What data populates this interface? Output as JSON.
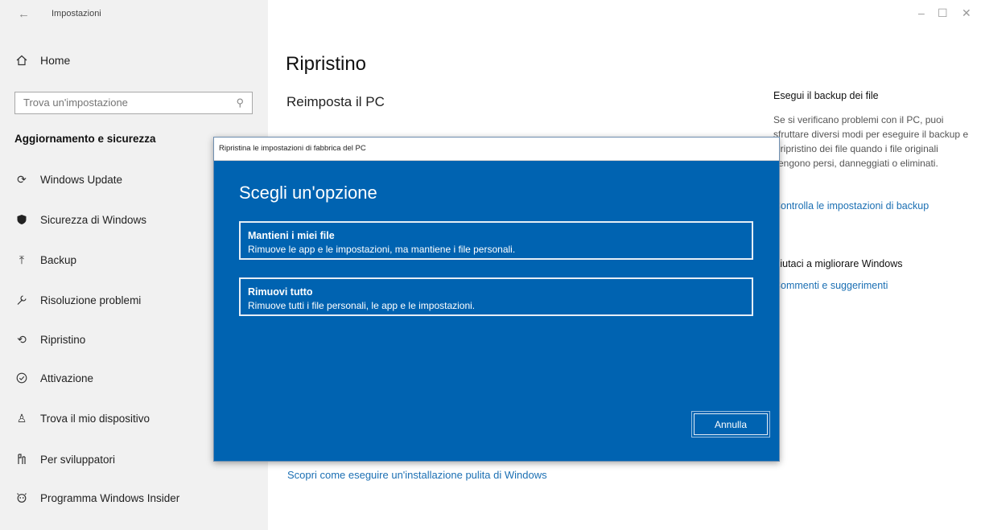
{
  "window": {
    "app_title": "Impostazioni",
    "controls": {
      "minimize": "–",
      "maximize": "☐",
      "close": "✕"
    }
  },
  "sidebar": {
    "home_label": "Home",
    "search_placeholder": "Trova un'impostazione",
    "section_title": "Aggiornamento e sicurezza",
    "items": [
      {
        "label": "Windows Update",
        "icon": "sync-icon"
      },
      {
        "label": "Sicurezza di Windows",
        "icon": "shield-icon"
      },
      {
        "label": "Backup",
        "icon": "backup-arrow-icon"
      },
      {
        "label": "Risoluzione problemi",
        "icon": "wrench-icon"
      },
      {
        "label": "Ripristino",
        "icon": "history-icon"
      },
      {
        "label": "Attivazione",
        "icon": "check-circle-icon"
      },
      {
        "label": "Trova il mio dispositivo",
        "icon": "person-pin-icon"
      },
      {
        "label": "Per sviluppatori",
        "icon": "developer-tools-icon"
      },
      {
        "label": "Programma Windows Insider",
        "icon": "insider-icon"
      }
    ]
  },
  "main": {
    "title": "Ripristino",
    "subtitle": "Reimposta il PC",
    "bottom_link": "Scopri come eseguire un'installazione pulita di Windows"
  },
  "right_panel": {
    "heading": "Esegui il backup dei file",
    "text": "Se si verificano problemi con il PC, puoi sfruttare diversi modi per eseguire il backup e il ripristino dei file quando i file originali vengono persi, danneggiati o eliminati.",
    "link": "Controlla le impostazioni di backup",
    "heading2": "Aiutaci a migliorare Windows",
    "link2": "Commenti e suggerimenti"
  },
  "dialog": {
    "title": "Ripristina le impostazioni di fabbrica del PC",
    "heading": "Scegli un'opzione",
    "options": [
      {
        "title": "Mantieni i miei file",
        "description": "Rimuove le app e le impostazioni, ma mantiene i file personali."
      },
      {
        "title": "Rimuovi tutto",
        "description": "Rimuove tutti i file personali, le app e le impostazioni."
      }
    ],
    "cancel_label": "Annulla",
    "accent_color": "#0063b1"
  }
}
